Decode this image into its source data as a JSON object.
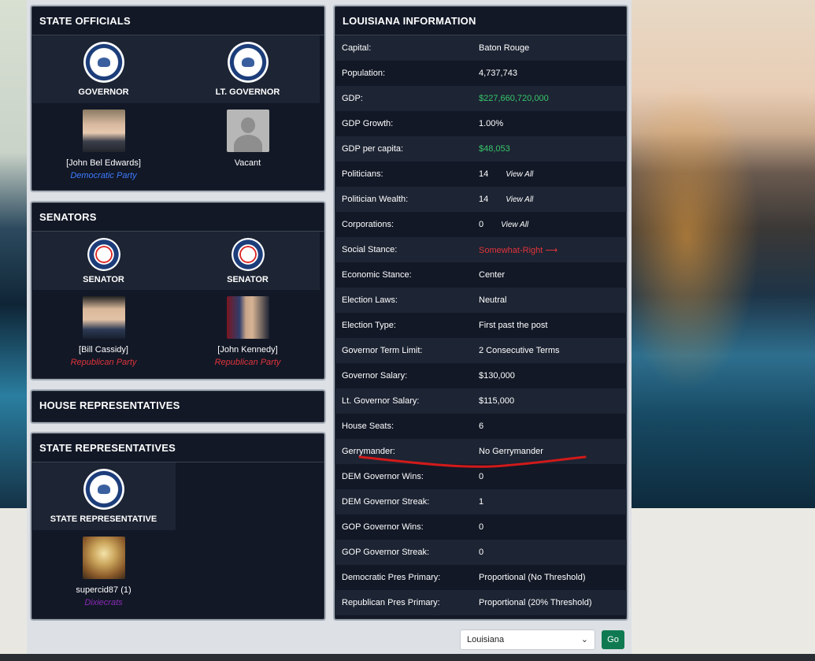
{
  "state_officials": {
    "title": "STATE OFFICIALS",
    "roles": [
      "GOVERNOR",
      "LT. GOVERNOR"
    ],
    "people": [
      {
        "name": "[John Bel Edwards]",
        "party": "Democratic Party"
      },
      {
        "name": "Vacant",
        "party": ""
      }
    ]
  },
  "senators": {
    "title": "SENATORS",
    "roles": [
      "SENATOR",
      "SENATOR"
    ],
    "people": [
      {
        "name": "[Bill Cassidy]",
        "party": "Republican Party"
      },
      {
        "name": "[John Kennedy]",
        "party": "Republican Party"
      }
    ]
  },
  "house_reps": {
    "title": "HOUSE REPRESENTATIVES"
  },
  "state_reps": {
    "title": "STATE REPRESENTATIVES",
    "role": "STATE REPRESENTATIVE",
    "person": {
      "name": "supercid87 (1)",
      "party": "Dixiecrats"
    }
  },
  "info": {
    "title": "LOUISIANA INFORMATION",
    "view_all": "View All",
    "rows": [
      {
        "k": "Capital:",
        "v": "Baton Rouge"
      },
      {
        "k": "Population:",
        "v": "4,737,743"
      },
      {
        "k": "GDP:",
        "v": "$227,660,720,000"
      },
      {
        "k": "GDP Growth:",
        "v": "1.00%"
      },
      {
        "k": "GDP per capita:",
        "v": "$48,053"
      },
      {
        "k": "Politicians:",
        "v": "14"
      },
      {
        "k": "Politician Wealth:",
        "v": "14"
      },
      {
        "k": "Corporations:",
        "v": "0"
      },
      {
        "k": "Social Stance:",
        "v": "Somewhat-Right"
      },
      {
        "k": "Economic Stance:",
        "v": "Center"
      },
      {
        "k": "Election Laws:",
        "v": "Neutral"
      },
      {
        "k": "Election Type:",
        "v": "First past the post"
      },
      {
        "k": "Governor Term Limit:",
        "v": "2 Consecutive Terms"
      },
      {
        "k": "Governor Salary:",
        "v": "$130,000"
      },
      {
        "k": "Lt. Governor Salary:",
        "v": "$115,000"
      },
      {
        "k": "House Seats:",
        "v": "6"
      },
      {
        "k": "Gerrymander:",
        "v": "No Gerrymander"
      },
      {
        "k": "DEM Governor Wins:",
        "v": "0"
      },
      {
        "k": "DEM Governor Streak:",
        "v": "1"
      },
      {
        "k": "GOP Governor Wins:",
        "v": "0"
      },
      {
        "k": "GOP Governor Streak:",
        "v": "0"
      },
      {
        "k": "Democratic Pres Primary:",
        "v": "Proportional (No Threshold)"
      },
      {
        "k": "Republican Pres Primary:",
        "v": "Proportional (20% Threshold)"
      }
    ]
  },
  "selector": {
    "value": "Louisiana",
    "go_label": "Go"
  },
  "colors": {
    "green": "#37c66b",
    "red": "#e0343b",
    "dem": "#3d7bff",
    "dixiecrat": "#8a2bb5",
    "panel": "#121826"
  }
}
